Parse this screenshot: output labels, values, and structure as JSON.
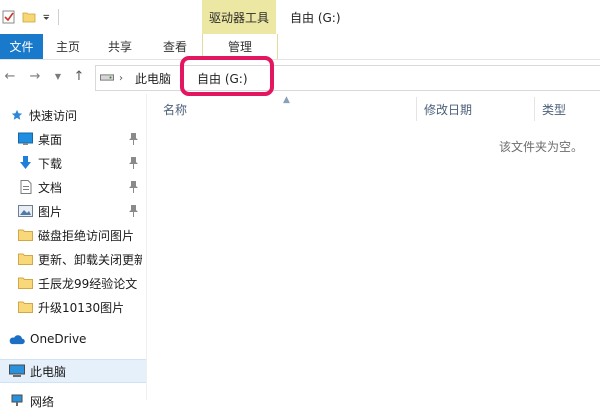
{
  "window": {
    "title": "自由 (G:)"
  },
  "context_tab": {
    "label": "驱动器工具"
  },
  "ribbon": {
    "tabs": [
      "文件",
      "主页",
      "共享",
      "查看",
      "管理"
    ]
  },
  "address": {
    "segments": [
      "此电脑",
      "自由 (G:)"
    ]
  },
  "nav": {
    "quick_access": "快速访问",
    "items": [
      {
        "label": "桌面",
        "icon": "desktop-icon",
        "pinned": true
      },
      {
        "label": "下载",
        "icon": "download-icon",
        "pinned": true
      },
      {
        "label": "文档",
        "icon": "document-icon",
        "pinned": true
      },
      {
        "label": "图片",
        "icon": "picture-icon",
        "pinned": true
      },
      {
        "label": "磁盘拒绝访问图片",
        "icon": "folder-icon",
        "pinned": false
      },
      {
        "label": "更新、卸载关闭更新",
        "icon": "folder-icon",
        "pinned": false
      },
      {
        "label": "壬辰龙99经验论文",
        "icon": "folder-icon",
        "pinned": false
      },
      {
        "label": "升级10130图片",
        "icon": "folder-icon",
        "pinned": false
      }
    ],
    "onedrive": "OneDrive",
    "this_pc": "此电脑",
    "network": "网络"
  },
  "columns": {
    "name": "名称",
    "modified": "修改日期",
    "type": "类型"
  },
  "content": {
    "empty_message": "该文件夹为空。"
  },
  "colors": {
    "accent": "#1979ca",
    "context": "#ece7a2",
    "highlight": "#e2175f",
    "selected": "#e5f0fb"
  }
}
